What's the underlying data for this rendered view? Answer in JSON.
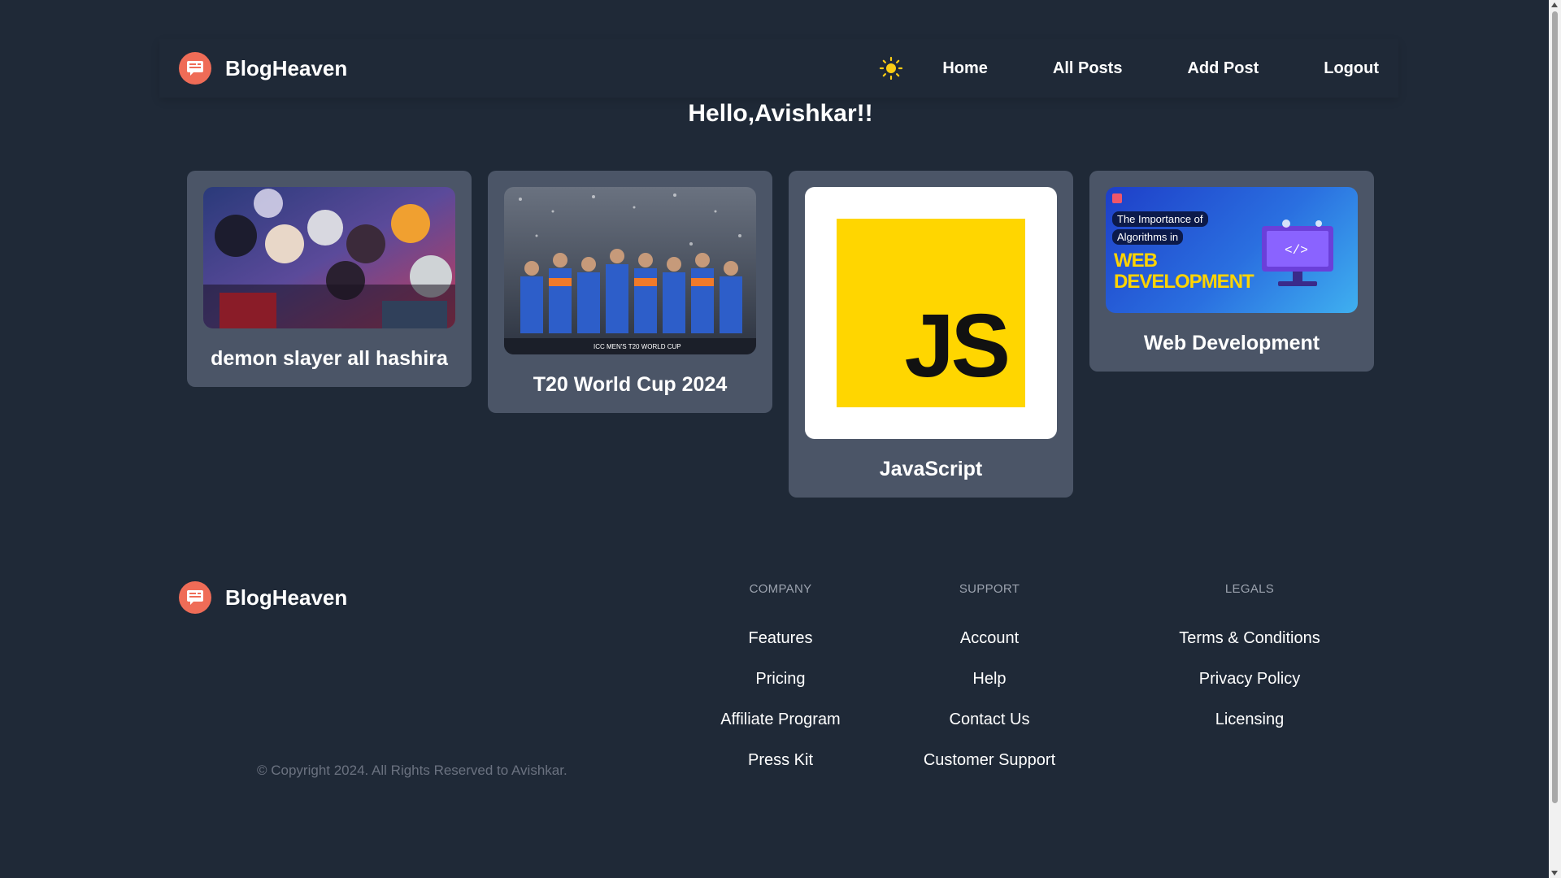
{
  "header": {
    "brand": "BlogHeaven",
    "theme_icon": "sun-icon",
    "nav": [
      "Home",
      "All Posts",
      "Add Post",
      "Logout"
    ]
  },
  "greeting": "Hello,Avishkar!!",
  "posts": [
    {
      "title": "demon slayer all hashira"
    },
    {
      "title": "T20 World Cup 2024",
      "image_caption": "ICC MEN'S T20 WORLD CUP"
    },
    {
      "title": "JavaScript",
      "image_text": "JS"
    },
    {
      "title": "Web Development",
      "image_line1": "The Importance of",
      "image_line2": "Algorithms in",
      "image_big1": "WEB",
      "image_big2": "DEVELOPMENT"
    }
  ],
  "footer": {
    "brand": "BlogHeaven",
    "copyright": "© Copyright 2024. All Rights Reserved to Avishkar.",
    "columns": [
      {
        "heading": "COMPANY",
        "links": [
          "Features",
          "Pricing",
          "Affiliate Program",
          "Press Kit"
        ]
      },
      {
        "heading": "SUPPORT",
        "links": [
          "Account",
          "Help",
          "Contact Us",
          "Customer Support"
        ]
      },
      {
        "heading": "LEGALS",
        "links": [
          "Terms & Conditions",
          "Privacy Policy",
          "Licensing"
        ]
      }
    ]
  },
  "colors": {
    "background": "#1f2937",
    "card": "#4b5567",
    "logo": "#ef6c57",
    "js_yellow": "#ffd600"
  }
}
